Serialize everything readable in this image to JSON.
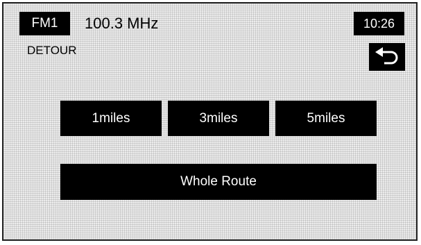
{
  "status_bar": {
    "band": "FM1",
    "frequency": "100.3 MHz",
    "clock": "10:26"
  },
  "screen": {
    "title": "DETOUR"
  },
  "back_button": {
    "icon": "back-arrow-icon"
  },
  "detour_options": {
    "distances": [
      "1miles",
      "3miles",
      "5miles"
    ],
    "whole_route": "Whole Route"
  },
  "colors": {
    "button_bg": "#000000",
    "button_text": "#ffffff",
    "screen_bg": "#ececec"
  }
}
